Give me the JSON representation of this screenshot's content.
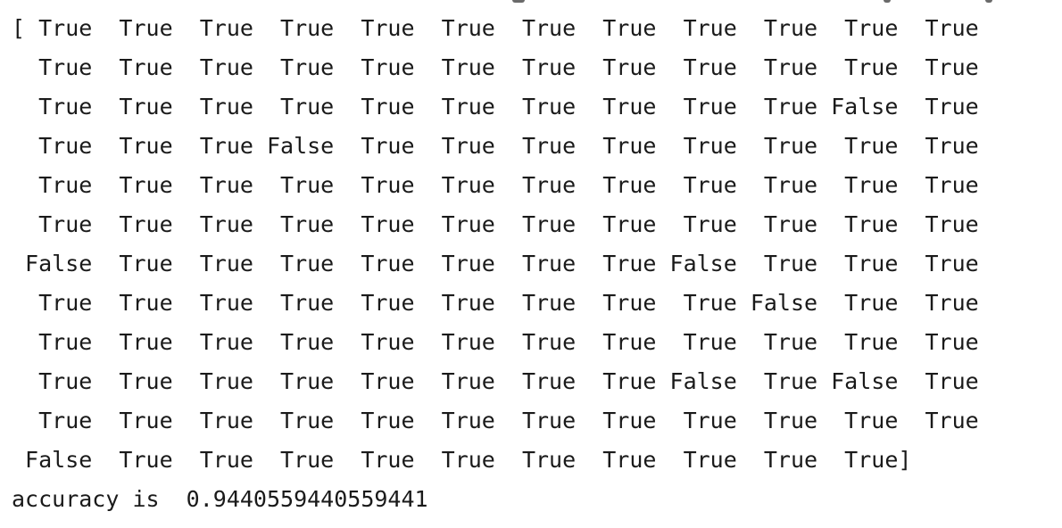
{
  "output": {
    "array_lines": [
      "[ True  True  True  True  True  True  True  True  True  True  True  True",
      "  True  True  True  True  True  True  True  True  True  True  True  True",
      "  True  True  True  True  True  True  True  True  True  True False  True",
      "  True  True  True False  True  True  True  True  True  True  True  True",
      "  True  True  True  True  True  True  True  True  True  True  True  True",
      "  True  True  True  True  True  True  True  True  True  True  True  True",
      " False  True  True  True  True  True  True  True False  True  True  True",
      "  True  True  True  True  True  True  True  True  True False  True  True",
      "  True  True  True  True  True  True  True  True  True  True  True  True",
      "  True  True  True  True  True  True  True  True False  True False  True",
      "  True  True  True  True  True  True  True  True  True  True  True  True",
      " False  True  True  True  True  True  True  True  True  True  True]"
    ],
    "accuracy_line": "accuracy is  0.9440559440559441"
  }
}
